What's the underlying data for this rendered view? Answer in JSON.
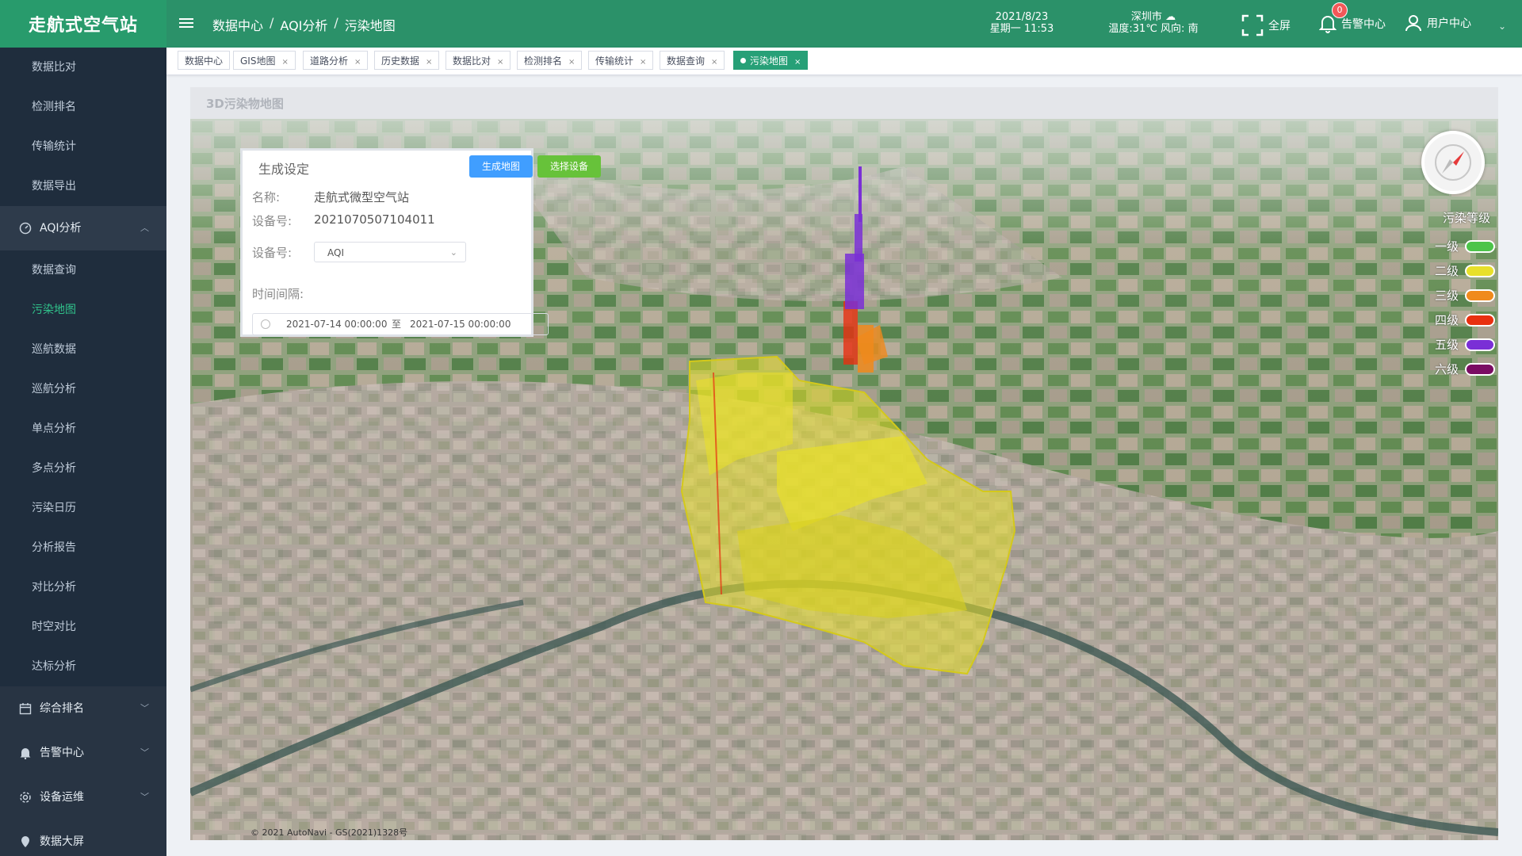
{
  "app": {
    "title": "走航式空气站"
  },
  "breadcrumb": [
    "数据中心",
    "AQI分析",
    "污染地图"
  ],
  "datetime": {
    "date": "2021/8/23",
    "weekday_time": "星期一 11:53"
  },
  "weather": {
    "city": "深圳市",
    "icon": "cloud-icon",
    "detail": "温度:31℃ 风向: 南"
  },
  "top_actions": {
    "fullscreen": "全屏",
    "alarm": "告警中心",
    "alarm_count": "0",
    "user": "用户中心"
  },
  "sidebar": {
    "pre_items": [
      "数据比对",
      "检测排名",
      "传输统计",
      "数据导出"
    ],
    "aqi_group": {
      "label": "AQI分析",
      "icon": "gauge-icon"
    },
    "aqi_items": [
      "数据查询",
      "污染地图",
      "巡航数据",
      "巡航分析",
      "单点分析",
      "多点分析",
      "污染日历",
      "分析报告",
      "对比分析",
      "时空对比",
      "达标分析"
    ],
    "active_item": "污染地图",
    "groups": [
      {
        "label": "综合排名",
        "icon": "calendar-icon"
      },
      {
        "label": "告警中心",
        "icon": "bell-icon"
      },
      {
        "label": "设备运维",
        "icon": "gear-icon"
      },
      {
        "label": "数据大屏",
        "icon": "location-icon"
      }
    ]
  },
  "tabs": [
    {
      "label": "数据中心",
      "closable": false
    },
    {
      "label": "GIS地图",
      "closable": true
    },
    {
      "label": "道路分析",
      "closable": true
    },
    {
      "label": "历史数据",
      "closable": true
    },
    {
      "label": "数据比对",
      "closable": true
    },
    {
      "label": "检测排名",
      "closable": true
    },
    {
      "label": "传输统计",
      "closable": true
    },
    {
      "label": "数据查询",
      "closable": true
    },
    {
      "label": "污染地图",
      "closable": true,
      "active": true
    }
  ],
  "page": {
    "title": "3D污染物地图"
  },
  "panel": {
    "title": "生成设定",
    "generate_button": "生成地图",
    "select_button": "选择设备",
    "name_label": "名称:",
    "name_value": "走航式微型空气站",
    "device_id_label": "设备号:",
    "device_id_value": "2021070507104011",
    "device_select_label": "设备号:",
    "device_select_value": "AQI",
    "interval_label": "时间间隔:",
    "start_time": "2021-07-14 00:00:00",
    "range_sep": "至",
    "end_time": "2021-07-15 00:00:00"
  },
  "legend": {
    "title": "污染等级",
    "levels": [
      {
        "label": "一级",
        "color": "#4cc44a"
      },
      {
        "label": "二级",
        "color": "#e8e02a"
      },
      {
        "label": "三级",
        "color": "#f08a1c"
      },
      {
        "label": "四级",
        "color": "#e83010"
      },
      {
        "label": "五级",
        "color": "#7a2fd6"
      },
      {
        "label": "六级",
        "color": "#7a0c63"
      }
    ]
  },
  "map": {
    "copyright": "© 2021 AutoNavi - GS(2021)1328号"
  }
}
